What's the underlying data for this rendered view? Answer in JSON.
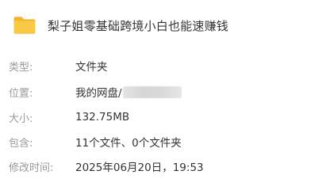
{
  "folder": {
    "icon": "folder-icon",
    "icon_color": "#F7C744",
    "name": "梨子姐零基础跨境小白也能速赚钱"
  },
  "properties": {
    "type": {
      "label": "类型:",
      "value": "文件夹"
    },
    "location": {
      "label": "位置:",
      "value": "我的网盘/"
    },
    "size": {
      "label": "大小:",
      "value": "132.75MB"
    },
    "contains": {
      "label": "包含:",
      "value": "11个文件、0个文件夹"
    },
    "modified": {
      "label": "修改时间:",
      "value": "2025年06月20日，19:53"
    }
  },
  "colors": {
    "label": "#9a9a9a",
    "value": "#333333",
    "background": "#ffffff"
  }
}
